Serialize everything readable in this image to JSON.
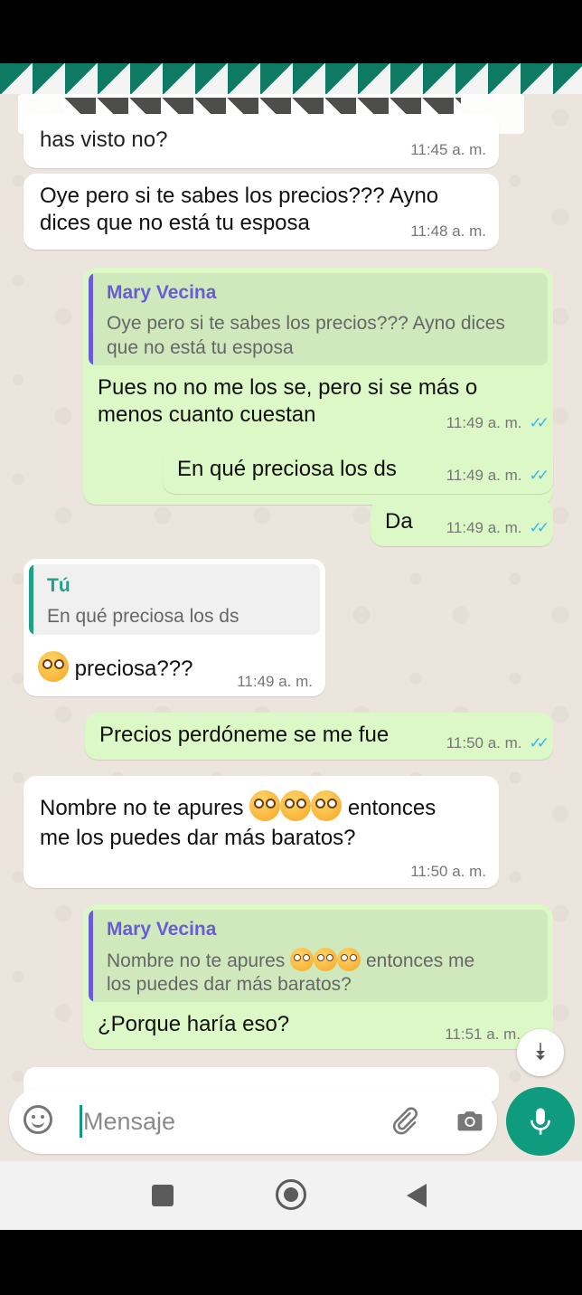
{
  "messages": [
    {
      "text": "has visto no?",
      "time": "11:45 a. m."
    },
    {
      "text_line1": "Oye pero si te sabes los precios??? Ayno",
      "text_line2": "dices que no está tu esposa",
      "time": "11:48 a. m."
    },
    {
      "quote_name": "Mary Vecina",
      "quote_line1": "Oye pero si te sabes los precios??? Ayno dices",
      "quote_line2": "que no está tu esposa",
      "text_line1": "Pues no no me los se, pero si se más o",
      "text_line2": "menos cuanto cuestan",
      "time": "11:49 a. m."
    },
    {
      "text": "En qué preciosa los ds",
      "time": "11:49 a. m."
    },
    {
      "text": "Da",
      "time": "11:49 a. m."
    },
    {
      "quote_name": "Tú",
      "quote_text": "En qué preciosa los ds",
      "text": "preciosa???",
      "time": "11:49 a. m."
    },
    {
      "text": "Precios perdóneme se me fue",
      "time": "11:50 a. m."
    },
    {
      "text_part1": "Nombre no te apures",
      "text_part2": "entonces",
      "text_line2": "me los puedes dar más baratos?",
      "time": "11:50 a. m."
    },
    {
      "quote_name": "Mary Vecina",
      "quote_part1": "Nombre no te apures",
      "quote_part2": "entonces me",
      "quote_line2": "los puedes dar más baratos?",
      "text": "¿Porque haría eso?",
      "time": "11:51 a. m."
    }
  ],
  "input": {
    "placeholder": "Mensaje"
  },
  "icons": {
    "emoji": "emoji-icon",
    "attach": "paperclip-icon",
    "camera": "camera-icon",
    "mic": "microphone-icon",
    "scroll": "double-chevron-down-icon",
    "ticks": "double-check-icon",
    "flushed": "flushed-face-emoji"
  },
  "colors": {
    "chat_bg": "#ece5dd",
    "incoming": "#ffffff",
    "outgoing": "#dcf8c6",
    "accent": "#0f9b7e",
    "read_ticks": "#34b7f1",
    "quote_name_out": "#6b5bd6",
    "quote_name_in": "#1fa187"
  }
}
